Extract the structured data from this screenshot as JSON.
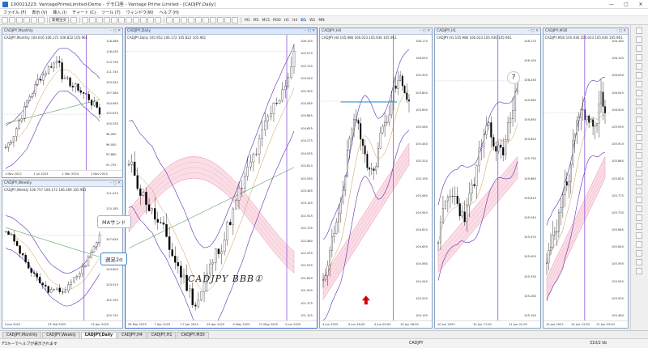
{
  "app": {
    "title": "100021223: VantagePrimeLimited-Demo - デモ口座 - Vantage Prime Limited - [CADJPY,Daily]",
    "window_controls": [
      "—",
      "▢",
      "✕"
    ]
  },
  "menu": [
    "ファイル (F)",
    "表示 (V)",
    "挿入 (I)",
    "チャート (C)",
    "ツール (T)",
    "ウィンドウ(W)",
    "ヘルプ (H)"
  ],
  "toolbar": {
    "new_order_label": "新規注文",
    "timeframes": [
      "M1",
      "M5",
      "M15",
      "M30",
      "H1",
      "H4",
      "D1",
      "W1",
      "MN"
    ],
    "active_timeframe": "D1"
  },
  "charts": {
    "monthly": {
      "title": "CADJPY,Monthly",
      "info": "CADJPY,Monthly  104.616 106.172 106.822 105.961",
      "prices": [
        "118.466",
        "116.435",
        "113.790",
        "111.745",
        "109.420",
        "107.380",
        "104.965",
        "102.670",
        "100.335",
        "98.260",
        "96.000",
        "93.880",
        "91.725"
      ],
      "dates": [
        "1 Nov 2022",
        "1 Jul 2023",
        "1 Mar 2024",
        "1 Nov 2024"
      ],
      "label_box": "105.961"
    },
    "weekly": {
      "title": "CADJPY,Weekly",
      "info": "CADJPY,Weekly  106.757 106.172 106.269 105.961",
      "prices": [
        "111.415",
        "110.185",
        "108.805",
        "107.630",
        "106.205",
        "104.600",
        "103.515",
        "102.195",
        "100.720"
      ],
      "dates": [
        "5 Jan 2025",
        "23 Feb 2025",
        "13 Apr 2025"
      ]
    },
    "daily": {
      "title": "CADJPY,Daily",
      "info": "CADJPY,Daily  105.952 106.172 105.822 105.961",
      "prices": [
        "106.155",
        "105.970",
        "105.745",
        "105.520",
        "105.305",
        "105.085",
        "104.865",
        "104.655",
        "104.275",
        "104.035",
        "103.810",
        "103.590",
        "103.365",
        "103.145",
        "102.925",
        "102.705",
        "102.480",
        "102.255",
        "102.035",
        "101.820",
        "101.595",
        "101.375",
        "101.155"
      ],
      "dates": [
        "26 Mar 2025",
        "7 Apr 2025",
        "17 Apr 2025",
        "29 Apr 2025",
        "9 May 2025",
        "21 May 2025",
        "2 Jun 2025"
      ],
      "label_box": "105.961"
    },
    "h4": {
      "title": "CADJPY,H4",
      "info": "CADJPY,H4  105.986 106.033 105.936 105.961",
      "prices": [
        "106.170",
        "106.050",
        "105.920",
        "105.800",
        "105.690",
        "105.560",
        "105.440",
        "105.310",
        "105.190",
        "105.060",
        "104.940",
        "104.810",
        "104.690",
        "104.560",
        "104.440",
        "104.320",
        "104.190"
      ],
      "dates": [
        "4 Jun 2025",
        "5 Jun 16:00",
        "9 Jun 00:00",
        "10 Jun 08:00"
      ]
    },
    "h1": {
      "title": "CADJPY,H1",
      "info": "CADJPY,H1  105.986 106.033 105.936 105.961",
      "prices": [
        "106.175",
        "106.100",
        "106.030",
        "105.960",
        "105.890",
        "105.820",
        "105.750",
        "105.680",
        "105.610",
        "105.540",
        "105.470",
        "105.400",
        "105.330",
        "105.260",
        "105.190"
      ],
      "dates": [
        "10 Jun 2025",
        "10 Jun 17:00",
        "11 Jun 01:00"
      ]
    },
    "m30": {
      "title": "CADJPY,M30",
      "info": "CADJPY,M30  105.936 106.033 105.936 105.961",
      "prices": [
        "106.180",
        "106.135",
        "106.090",
        "106.045",
        "106.000",
        "105.955",
        "105.910",
        "105.865",
        "105.820",
        "105.775",
        "105.730",
        "105.685",
        "105.640",
        "105.595",
        "105.550",
        "105.505",
        "105.460"
      ],
      "dates": [
        "10 Jun 2025",
        "10 Jun 13:30",
        "11 Jun 03:00"
      ]
    }
  },
  "annotations": {
    "ma_sand": "MAサンド",
    "weekly_2sigma": "週足2σ",
    "bbb_title": "CADJPY  BBB①",
    "question": "?"
  },
  "tabs": [
    "CADJPY,Monthly",
    "CADJPY,Weekly",
    "CADJPY,Daily",
    "CADJPY,H4",
    "CADJPY,H1",
    "CADJPY,M30"
  ],
  "active_tab": "CADJPY,Daily",
  "status": {
    "help": "F1キーでヘルプが表示されます",
    "symbol": "CADJPY",
    "traffic": "310/2 kb"
  },
  "colors": {
    "bull": "#ffffff",
    "bear": "#000000",
    "bands": "#5b2fb0",
    "ichimoku_cloud": "#f4b6c8",
    "ma_green": "#2e8b2e",
    "highlight_line": "#2b8fd6",
    "arrow_red": "#d40000"
  }
}
